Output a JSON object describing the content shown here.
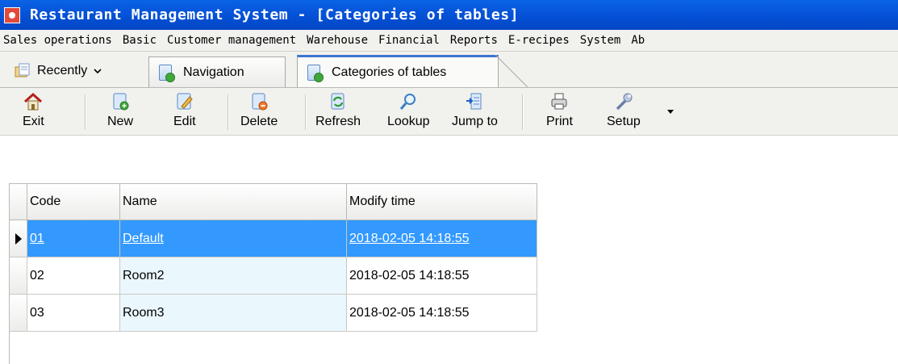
{
  "window": {
    "title": "Restaurant Management System - [Categories of tables]"
  },
  "menu": [
    {
      "label": "Sales operations"
    },
    {
      "label": "Basic"
    },
    {
      "label": "Customer management"
    },
    {
      "label": "Warehouse"
    },
    {
      "label": "Financial"
    },
    {
      "label": "Reports"
    },
    {
      "label": "E-recipes"
    },
    {
      "label": "System"
    },
    {
      "label": "Ab"
    }
  ],
  "tabs": {
    "recently": "Recently",
    "items": [
      {
        "label": "Navigation"
      },
      {
        "label": "Categories of tables",
        "active": true
      }
    ]
  },
  "toolbar": {
    "buttons": [
      {
        "label": "Exit",
        "icon": "home-icon"
      },
      {
        "label": "New",
        "icon": "new-document-icon"
      },
      {
        "label": "Edit",
        "icon": "edit-pencil-icon"
      },
      {
        "label": "Delete",
        "icon": "delete-document-icon"
      },
      {
        "label": "Refresh",
        "icon": "refresh-icon"
      },
      {
        "label": "Lookup",
        "icon": "magnifier-icon"
      },
      {
        "label": "Jump to",
        "icon": "jump-to-icon"
      },
      {
        "label": "Print",
        "icon": "printer-icon"
      },
      {
        "label": "Setup",
        "icon": "wrench-icon"
      }
    ]
  },
  "grid": {
    "columns": [
      "Code",
      "Name",
      "Modify time"
    ],
    "rows": [
      {
        "code": "01",
        "name": "Default",
        "modified": "2018-02-05 14:18:55",
        "selected": true
      },
      {
        "code": "02",
        "name": "Room2",
        "modified": "2018-02-05 14:18:55",
        "selected": false
      },
      {
        "code": "03",
        "name": "Room3",
        "modified": "2018-02-05 14:18:55",
        "selected": false
      }
    ]
  },
  "colors": {
    "titlebar": "#0550d6",
    "selection": "#3399ff",
    "name_column": "#eaf7fd",
    "chrome": "#f1f1ee"
  }
}
